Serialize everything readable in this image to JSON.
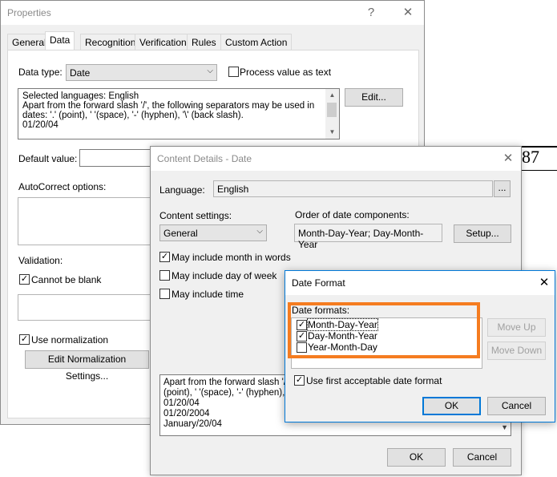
{
  "background_text": "87",
  "properties": {
    "title": "Properties",
    "help_label": "?",
    "close_label": "✕",
    "tabs": [
      "General",
      "Data",
      "Recognition",
      "Verification",
      "Rules",
      "Custom Action"
    ],
    "data_type_label": "Data type:",
    "data_type_value": "Date",
    "process_value_label": "Process value as text",
    "info_lines": [
      "Selected languages: English",
      "Apart from the forward slash '/', the following separators may be used in",
      "dates: '.' (point), ' '(space), '-' (hyphen), '\\' (back slash).",
      "01/20/04"
    ],
    "edit_label": "Edit...",
    "default_value_label": "Default value:",
    "autocorrect_label": "AutoCorrect options:",
    "validation_label": "Validation:",
    "cannot_be_blank_label": "Cannot be blank",
    "use_normalization_label": "Use normalization",
    "edit_normalization_label": "Edit Normalization Settings..."
  },
  "content_details": {
    "title": "Content Details - Date",
    "close_label": "✕",
    "language_label": "Language:",
    "language_value": "English",
    "browse_label": "...",
    "content_settings_label": "Content settings:",
    "content_settings_value": "General",
    "order_label": "Order of date components:",
    "order_value": "Month-Day-Year; Day-Month-Year",
    "setup_label": "Setup...",
    "month_words_label": "May include month in words",
    "day_week_label": "May include day of week",
    "time_label": "May include time",
    "sample_lines": [
      "Apart from the forward slash '/',",
      "(point), ' '(space), '-' (hyphen),",
      "01/20/04",
      "01/20/2004",
      "January/20/04"
    ],
    "ok_label": "OK",
    "cancel_label": "Cancel"
  },
  "date_format": {
    "title": "Date Format",
    "close_label": "✕",
    "formats_label": "Date formats:",
    "formats": [
      {
        "label": "Month-Day-Year",
        "checked": true
      },
      {
        "label": "Day-Month-Year",
        "checked": true
      },
      {
        "label": "Year-Month-Day",
        "checked": false
      }
    ],
    "move_up_label": "Move Up",
    "move_down_label": "Move Down",
    "first_acceptable_label": "Use first acceptable date format",
    "ok_label": "OK",
    "cancel_label": "Cancel"
  },
  "colors": {
    "highlight": "#f57c20",
    "accent": "#0078d7"
  }
}
